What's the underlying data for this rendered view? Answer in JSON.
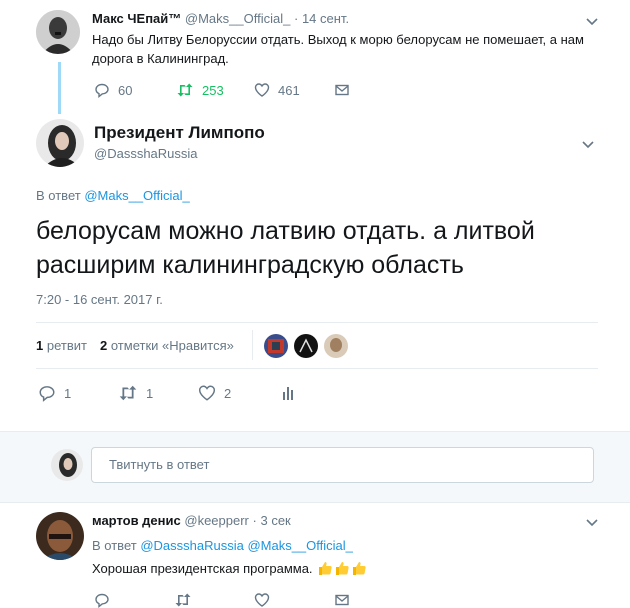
{
  "parent_tweet": {
    "display_name": "Макс ЧЕпай™",
    "handle": "@Maks__Official_",
    "separator": "·",
    "date": "14 сент.",
    "text": "Надо бы Литву Белоруссии отдать. Выход к морю белорусам не помешает, а нам дорога в Калининград.",
    "replies": "60",
    "retweets": "253",
    "likes": "461"
  },
  "main_tweet": {
    "display_name": "Президент Лимпопо",
    "handle": "@DassshaRussia",
    "reply_prefix": "В ответ",
    "reply_to": "@Maks__Official_",
    "text": "белорусам можно латвию отдать. а литвой расширим калининградскую область",
    "timestamp": "7:20 - 16 сент. 2017 г.",
    "retweet_count": "1",
    "retweet_label": "ретвит",
    "like_count": "2",
    "like_label": "отметки «Нравится»",
    "actions": {
      "replies": "1",
      "retweets": "1",
      "likes": "2"
    }
  },
  "reply_box": {
    "placeholder": "Твитнуть в ответ"
  },
  "reply_tweet": {
    "display_name": "мартов денис",
    "handle": "@keepperr",
    "separator": "·",
    "time": "3 сек",
    "reply_prefix": "В ответ",
    "reply_to": "@DassshaRussia @Maks__Official_",
    "text": "Хорошая президентская программа.",
    "emojis": [
      "thumbs-up",
      "thumbs-up",
      "thumbs-up"
    ]
  },
  "colors": {
    "link": "#1b95e0",
    "retweet_active": "#17bf63",
    "muted": "#657786",
    "thread_line": "#9fd9f7"
  }
}
